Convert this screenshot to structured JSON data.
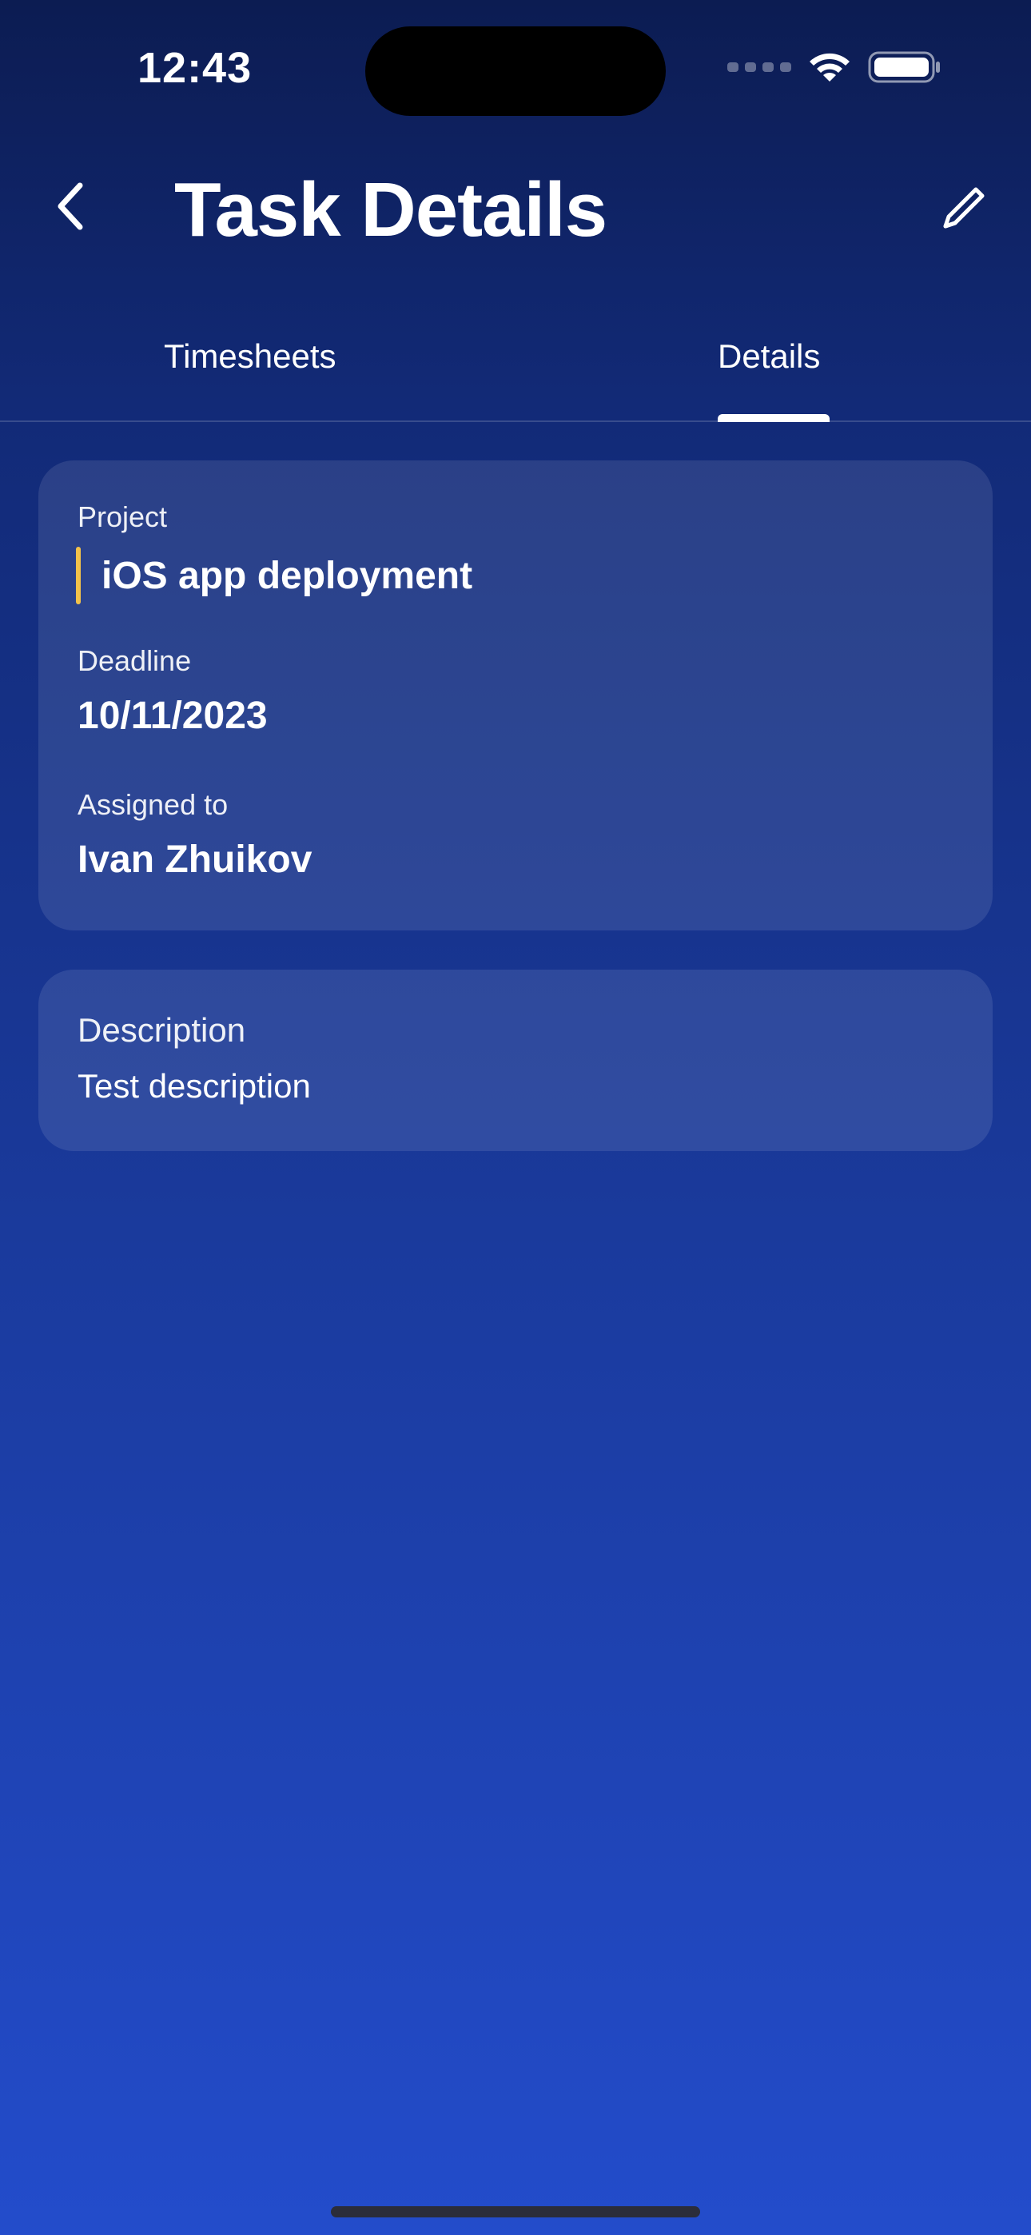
{
  "status_bar": {
    "time": "12:43",
    "icons": [
      "signal-icon",
      "wifi-icon",
      "battery-icon"
    ]
  },
  "header": {
    "title": "Task Details",
    "back_icon": "chevron-left-icon",
    "edit_icon": "pencil-icon"
  },
  "tabs": [
    {
      "label": "Timesheets",
      "active": false
    },
    {
      "label": "Details",
      "active": true
    }
  ],
  "details_card": {
    "project_label": "Project",
    "project_value": "iOS app deployment",
    "deadline_label": "Deadline",
    "deadline_value": "10/11/2023",
    "assigned_label": "Assigned to",
    "assigned_value": "Ivan Zhuikov"
  },
  "description_card": {
    "label": "Description",
    "value": "Test description"
  },
  "colors": {
    "background_top": "#0c1c52",
    "background_bottom": "#234ccb",
    "project_accent": "#f3c24a",
    "text": "#ffffff"
  }
}
